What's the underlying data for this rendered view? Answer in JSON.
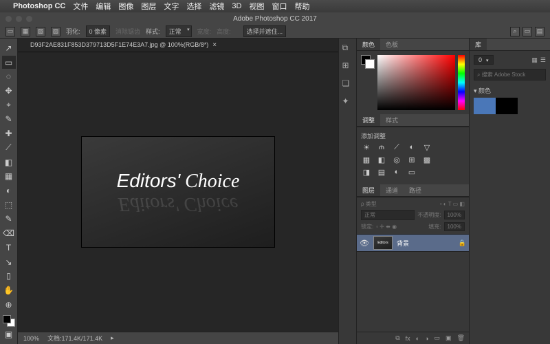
{
  "app_name": "Photoshop CC",
  "menus": [
    "文件",
    "编辑",
    "图像",
    "图层",
    "文字",
    "选择",
    "滤镜",
    "3D",
    "视图",
    "窗口",
    "帮助"
  ],
  "window_title": "Adobe Photoshop CC 2017",
  "options_bar": {
    "feather_label": "羽化:",
    "feather_value": "0 像素",
    "antialias": "消除锯齿",
    "style_label": "样式:",
    "style_value": "正常",
    "width_label": "宽度:",
    "height_label": "高度:",
    "refine": "选择并遮住..."
  },
  "document": {
    "tab_title": "D93F2AE831F853D379713D5F1E74E3A7.jpg @ 100%(RGB/8*)",
    "artwork_text": "Editors' Choice"
  },
  "statusbar": {
    "zoom": "100%",
    "docinfo": "文档:171.4K/171.4K"
  },
  "tools": [
    "↗",
    "▭",
    "◌",
    "✥",
    "⌖",
    "✎",
    "✚",
    "⟋",
    "◧",
    "▦",
    "◐",
    "⬚",
    "✎",
    "⌫",
    "T",
    "↘",
    "▯",
    "✋",
    "⊕"
  ],
  "collapsed_icons": [
    "⧉",
    "⊞",
    "❏",
    "✦"
  ],
  "panels": {
    "color": {
      "tabs": [
        "颜色",
        "色板"
      ]
    },
    "adjust": {
      "tabs": [
        "调整",
        "样式"
      ],
      "label": "添加调整"
    },
    "layers": {
      "tabs": [
        "图层",
        "通道",
        "路径"
      ],
      "kind": "ρ 类型",
      "blend": "正常",
      "opacity_label": "不透明度:",
      "opacity": "100%",
      "lock_label": "锁定:",
      "fill_label": "填充:",
      "fill": "100%",
      "items": [
        {
          "name": "背景"
        }
      ]
    }
  },
  "library": {
    "tab": "库",
    "zero": "0",
    "search_placeholder": "搜索 Adobe Stock",
    "section": "颜色",
    "swatches": [
      "#4a77b8",
      "#000000"
    ]
  }
}
